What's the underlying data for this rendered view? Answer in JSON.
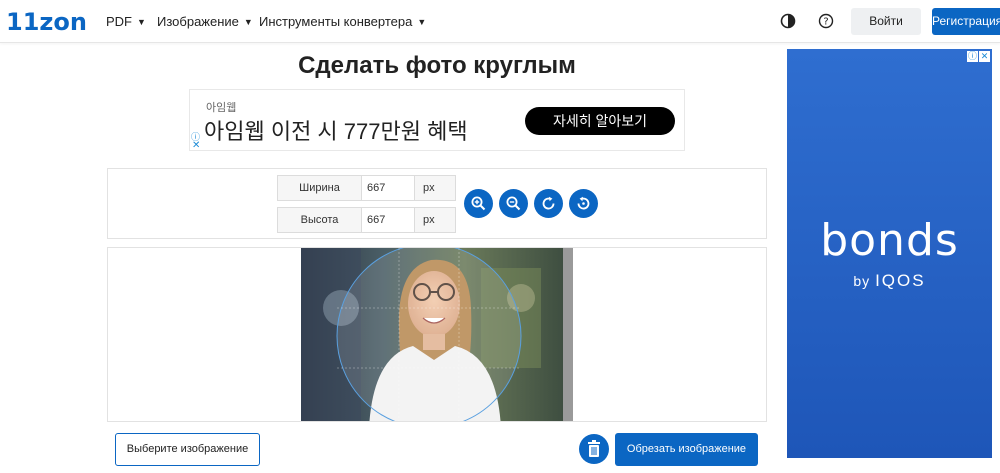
{
  "header": {
    "logo": "11zon",
    "nav": [
      {
        "label": "PDF"
      },
      {
        "label": "Изображение"
      },
      {
        "label": "Инструменты конвертера"
      }
    ],
    "login_label": "Войти",
    "register_label": "Регистрация"
  },
  "page": {
    "title": "Сделать фото круглым"
  },
  "ad_banner": {
    "small_text": "아임웹",
    "headline": "아임웹 이전 시 777만원 혜택",
    "cta": "자세히 알아보기"
  },
  "dimensions": {
    "width_label": "Ширина",
    "width_value": "667",
    "height_label": "Высота",
    "height_value": "667",
    "unit": "px"
  },
  "toolbar": {
    "icons": [
      "zoom-in-icon",
      "zoom-out-icon",
      "rotate-icon",
      "reset-icon"
    ]
  },
  "actions": {
    "select_label": "Выберите изображение",
    "crop_label": "Обрезать изображение"
  },
  "side_ad": {
    "brand": "bonds",
    "by_prefix": "by",
    "by_brand": "IQOS"
  },
  "colors": {
    "accent": "#0b66c3",
    "side_ad_bg": "#2a64c8"
  }
}
